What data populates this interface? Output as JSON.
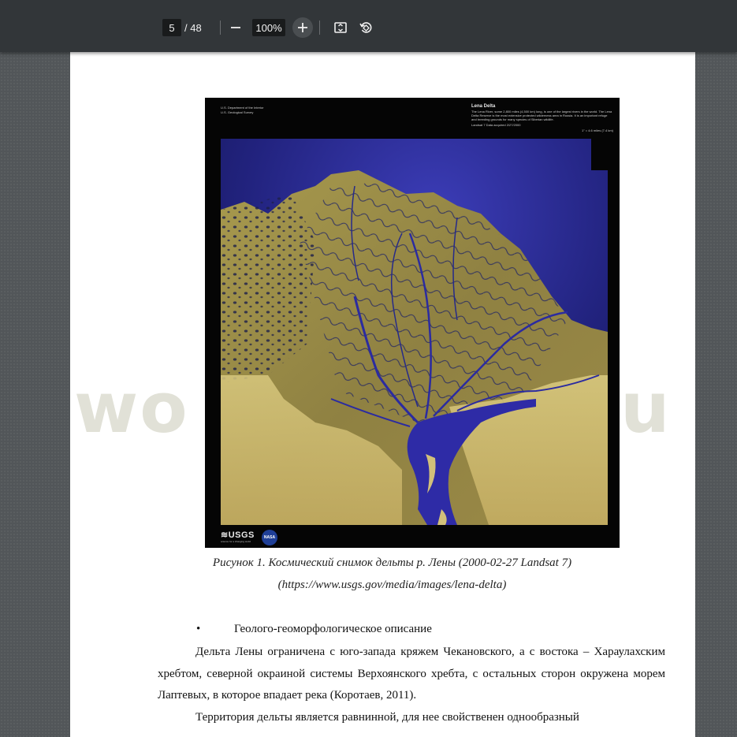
{
  "toolbar": {
    "current_page": "5",
    "page_total": "/ 48",
    "zoom": "100%",
    "zoom_out_icon": "minus-icon",
    "zoom_in_icon": "plus-icon",
    "fit_icon": "fit-page-icon",
    "rotate_icon": "rotate-icon"
  },
  "figure": {
    "header_left": [
      "U.S. Department of the Interior",
      "U.S. Geological Survey"
    ],
    "title": "Lena Delta",
    "description": "The Lena River, some 2,800 miles (4,500 km) long, is one of the largest rivers in the world. The Lena Delta Reserve is the most extensive protected wilderness area in Russia. It is an important refuge and breeding grounds for many species of Siberian wildlife.",
    "acquired": "Landsat 7 Data acquired 2/27/2000",
    "scale": "1\" = 4.6 miles (7.4 km)",
    "usgs_logo": "≋USGS",
    "usgs_tagline": "science for a changing world",
    "nasa_logo": "NASA",
    "colors": {
      "water": "#2b2a9c",
      "land": "#b9a45a",
      "sand": "#d9c77c",
      "background": "#050505"
    }
  },
  "caption": {
    "line1": "Рисунок 1. Космический снимок дельты р. Лены (2000-02-27 Landsat 7)",
    "line2": "(https://www.usgs.gov/media/images/lena-delta)"
  },
  "bullet": {
    "symbol": "•",
    "text": "Геолого-геоморфологическое описание"
  },
  "paragraphs": {
    "p1": "Дельта Лены ограничена с юго-запада кряжем Чекановского, а с востока – Хараулахским хребтом, северной окраиной системы Верхоянского хребта, с остальных сторон окружена морем Лаптевых, в которое впадает река (Коротаев, 2011).",
    "p2": "Территория дельты является равнинной, для нее свойственен однообразный"
  },
  "watermark": {
    "left": "wo",
    "right": "u"
  }
}
